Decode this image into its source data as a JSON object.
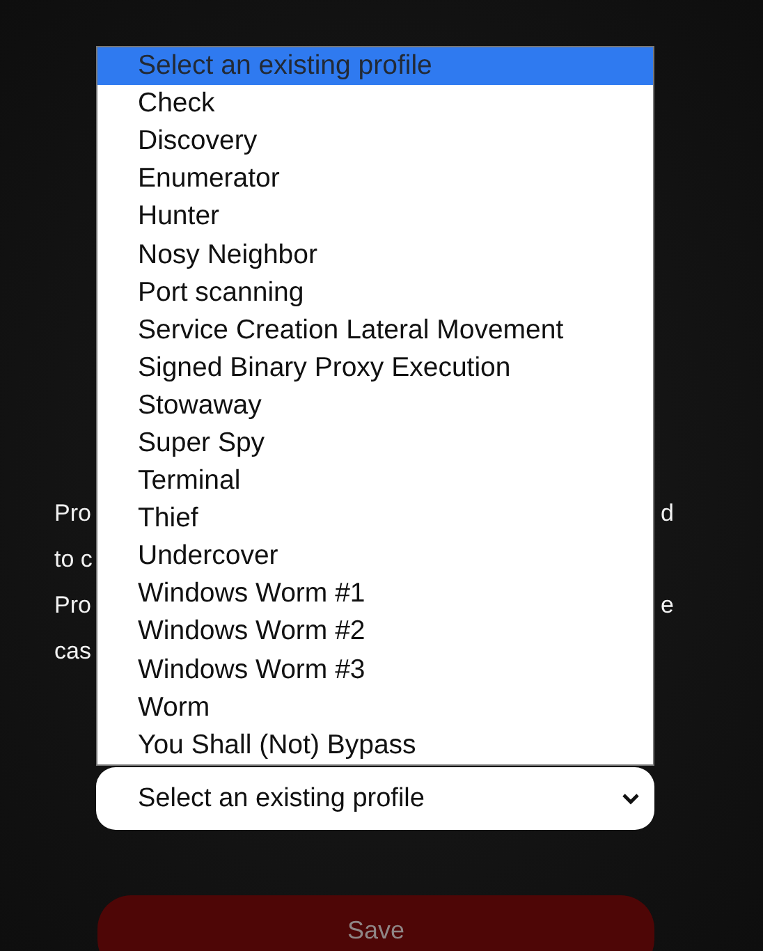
{
  "paragraph_lines": [
    {
      "left": "Pro",
      "right": "d"
    },
    {
      "left": "to c"
    },
    {
      "left": "Pro",
      "right": "e"
    },
    {
      "left": "cas"
    }
  ],
  "profile_list": {
    "options": [
      {
        "label": "Select an existing profile",
        "selected": true,
        "disabled": true
      },
      {
        "label": "Check",
        "selected": false,
        "disabled": false
      },
      {
        "label": "Discovery",
        "selected": false,
        "disabled": false
      },
      {
        "label": "Enumerator",
        "selected": false,
        "disabled": false
      },
      {
        "label": "Hunter",
        "selected": false,
        "disabled": false
      },
      {
        "label": "Nosy Neighbor",
        "selected": false,
        "disabled": false
      },
      {
        "label": "Port scanning",
        "selected": false,
        "disabled": false
      },
      {
        "label": "Service Creation Lateral Movement",
        "selected": false,
        "disabled": false
      },
      {
        "label": "Signed Binary Proxy Execution",
        "selected": false,
        "disabled": false
      },
      {
        "label": "Stowaway",
        "selected": false,
        "disabled": false
      },
      {
        "label": "Super Spy",
        "selected": false,
        "disabled": false
      },
      {
        "label": "Terminal",
        "selected": false,
        "disabled": false
      },
      {
        "label": "Thief",
        "selected": false,
        "disabled": false
      },
      {
        "label": "Undercover",
        "selected": false,
        "disabled": false
      },
      {
        "label": "Windows Worm #1",
        "selected": false,
        "disabled": false
      },
      {
        "label": "Windows Worm #2",
        "selected": false,
        "disabled": false
      },
      {
        "label": "Windows Worm #3",
        "selected": false,
        "disabled": false
      },
      {
        "label": "Worm",
        "selected": false,
        "disabled": false
      },
      {
        "label": "You Shall (Not) Bypass",
        "selected": false,
        "disabled": false
      }
    ]
  },
  "profile_select": {
    "value": "Select an existing profile"
  },
  "save_button": {
    "label": "Save",
    "disabled": true
  }
}
